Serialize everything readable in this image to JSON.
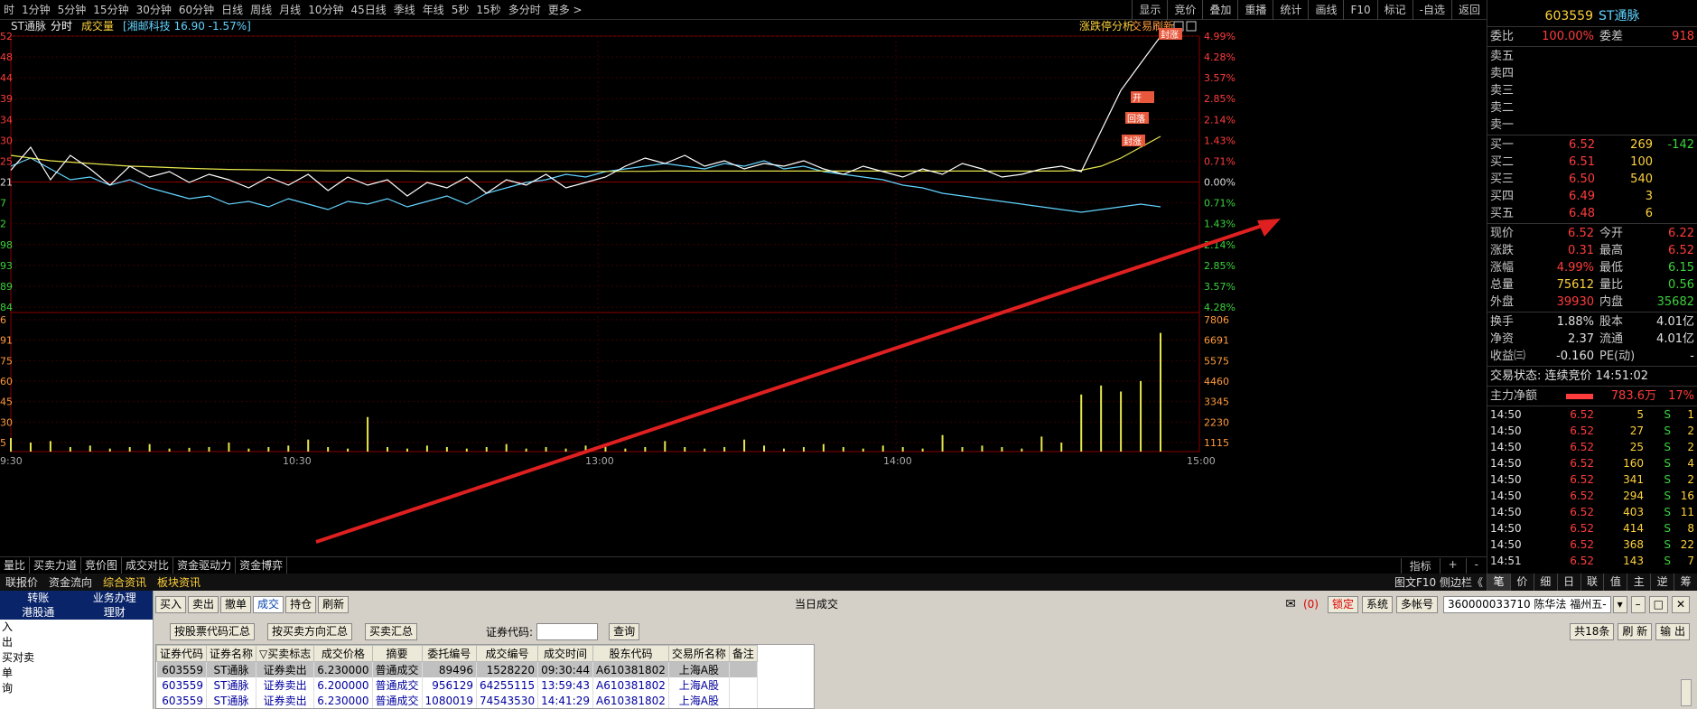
{
  "periods": [
    "时",
    "1分钟",
    "5分钟",
    "15分钟",
    "30分钟",
    "60分钟",
    "日线",
    "周线",
    "月线",
    "10分钟",
    "45日线",
    "季线",
    "年线",
    "5秒",
    "15秒",
    "多分时",
    "更多 >"
  ],
  "top_right": [
    "显示",
    "竞价",
    "叠加",
    "重播",
    "统计",
    "画线",
    "F10",
    "标记",
    "-自选",
    "返回"
  ],
  "chart_header": {
    "name": "ST通脉",
    "mode": "分时",
    "vol": "成交量",
    "compare": "[湘邮科技 16.90 -1.57%]",
    "right1": "涨跌停分析",
    "right2": "交易刷新"
  },
  "chart_data": {
    "type": "line",
    "title": "",
    "pct_axis_right": [
      "4.99%",
      "4.28%",
      "3.57%",
      "2.85%",
      "2.14%",
      "1.43%",
      "0.71%",
      "0.00%",
      "0.71%",
      "1.43%",
      "2.14%",
      "2.85%",
      "3.57%",
      "4.28%"
    ],
    "price_axis_left": [
      "52",
      "48",
      "44",
      "39",
      "34",
      "30",
      "25",
      "21",
      "7",
      "2",
      "98",
      "93",
      "89",
      "84"
    ],
    "vol_axis_right": [
      "7806",
      "6691",
      "5575",
      "4460",
      "3345",
      "2230",
      "1115"
    ],
    "vol_axis_left": [
      "6",
      "91",
      "75",
      "60",
      "45",
      "30",
      "5"
    ],
    "time_labels": [
      "9:30",
      "10:30",
      "13:00",
      "14:00",
      "15:00"
    ],
    "price_series": [
      0.05,
      0.9,
      -0.3,
      0.6,
      0.1,
      -0.5,
      0.2,
      -0.2,
      0.0,
      -0.4,
      -0.1,
      -0.3,
      -0.6,
      -0.2,
      -0.5,
      -0.1,
      -0.7,
      -0.2,
      -0.5,
      -0.3,
      -0.9,
      -0.4,
      -0.6,
      -0.2,
      -0.8,
      -0.3,
      -0.5,
      -0.1,
      -0.6,
      -0.4,
      -0.2,
      0.2,
      0.5,
      0.3,
      0.6,
      0.2,
      0.4,
      0.1,
      0.3,
      0.2,
      0.4,
      0.1,
      -0.1,
      0.2,
      0.0,
      -0.2,
      0.1,
      -0.1,
      0.3,
      0.1,
      -0.2,
      -0.1,
      0.1,
      0.2,
      0.0,
      1.5,
      3.0,
      4.0,
      4.99
    ],
    "avg_series": [
      0.6,
      0.5,
      0.4,
      0.35,
      0.3,
      0.25,
      0.2,
      0.18,
      0.15,
      0.12,
      0.1,
      0.08,
      0.07,
      0.06,
      0.05,
      0.04,
      0.03,
      0.03,
      0.02,
      0.02,
      0.02,
      0.01,
      0.01,
      0.01,
      0.01,
      0.01,
      0.01,
      0.01,
      0.01,
      0.01,
      0.01,
      0.01,
      0.01,
      0.02,
      0.02,
      0.02,
      0.02,
      0.02,
      0.02,
      0.02,
      0.02,
      0.02,
      0.02,
      0.02,
      0.02,
      0.02,
      0.02,
      0.02,
      0.02,
      0.02,
      0.02,
      0.02,
      0.02,
      0.02,
      0.05,
      0.2,
      0.5,
      0.9,
      1.3
    ],
    "compare_series": [
      0.2,
      0.5,
      0.1,
      -0.3,
      -0.2,
      -0.5,
      -0.3,
      -0.6,
      -0.8,
      -1.0,
      -0.9,
      -1.2,
      -1.1,
      -1.3,
      -1.0,
      -1.2,
      -1.4,
      -1.1,
      -1.2,
      -1.0,
      -1.3,
      -1.1,
      -0.9,
      -1.2,
      -0.8,
      -0.6,
      -0.4,
      -0.3,
      -0.1,
      -0.2,
      0.0,
      0.1,
      0.2,
      0.3,
      0.2,
      0.1,
      0.3,
      0.2,
      0.4,
      0.1,
      0.2,
      0.0,
      -0.1,
      -0.2,
      -0.3,
      -0.5,
      -0.6,
      -0.8,
      -0.9,
      -1.0,
      -1.1,
      -1.2,
      -1.3,
      -1.4,
      -1.5,
      -1.4,
      -1.3,
      -1.2,
      -1.3
    ],
    "volume_series": [
      900,
      600,
      700,
      300,
      400,
      200,
      300,
      500,
      200,
      250,
      300,
      600,
      200,
      300,
      400,
      800,
      300,
      200,
      2300,
      300,
      200,
      400,
      300,
      200,
      300,
      500,
      200,
      300,
      200,
      400,
      300,
      200,
      300,
      700,
      300,
      200,
      300,
      800,
      400,
      200,
      300,
      500,
      300,
      200,
      400,
      300,
      200,
      1100,
      300,
      400,
      300,
      200,
      1000,
      600,
      3800,
      4400,
      4000,
      4700,
      7900
    ],
    "labels": [
      "封涨",
      "开",
      "回落",
      "封涨"
    ]
  },
  "side": {
    "code": "603559",
    "name": "ST通脉",
    "tag": "封涨",
    "webi": {
      "l": "委比",
      "v": "100.00%",
      "l2": "委差",
      "v2": "918"
    },
    "sells": [
      {
        "l": "卖五"
      },
      {
        "l": "卖四"
      },
      {
        "l": "卖三"
      },
      {
        "l": "卖二"
      },
      {
        "l": "卖一"
      }
    ],
    "buys": [
      {
        "l": "买一",
        "p": "6.52",
        "v": "269",
        "d": "-142"
      },
      {
        "l": "买二",
        "p": "6.51",
        "v": "100",
        "d": ""
      },
      {
        "l": "买三",
        "p": "6.50",
        "v": "540",
        "d": ""
      },
      {
        "l": "买四",
        "p": "6.49",
        "v": "3",
        "d": ""
      },
      {
        "l": "买五",
        "p": "6.48",
        "v": "6",
        "d": ""
      }
    ],
    "quote": [
      {
        "l": "现价",
        "v": "6.52",
        "l2": "今开",
        "v2": "6.22",
        "c": "red",
        "c2": "red"
      },
      {
        "l": "涨跌",
        "v": "0.31",
        "l2": "最高",
        "v2": "6.52",
        "c": "red",
        "c2": "red"
      },
      {
        "l": "涨幅",
        "v": "4.99%",
        "l2": "最低",
        "v2": "6.15",
        "c": "red",
        "c2": "grn"
      },
      {
        "l": "总量",
        "v": "75612",
        "l2": "量比",
        "v2": "0.56",
        "c": "yel",
        "c2": "grn"
      },
      {
        "l": "外盘",
        "v": "39930",
        "l2": "内盘",
        "v2": "35682",
        "c": "red",
        "c2": "grn"
      }
    ],
    "quote2": [
      {
        "l": "换手",
        "v": "1.88%",
        "l2": "股本",
        "v2": "4.01亿"
      },
      {
        "l": "净资",
        "v": "2.37",
        "l2": "流通",
        "v2": "4.01亿"
      },
      {
        "l": "收益㈢",
        "v": "-0.160",
        "l2": "PE(动)",
        "v2": "-"
      }
    ],
    "status": "交易状态: 连续竞价 14:51:02",
    "mainflow": {
      "l": "主力净额",
      "v": "783.6万",
      "p": "17%"
    },
    "ticks": [
      {
        "t": "14:50",
        "p": "6.52",
        "v": "5",
        "s": "S",
        "n": "1"
      },
      {
        "t": "14:50",
        "p": "6.52",
        "v": "27",
        "s": "S",
        "n": "2"
      },
      {
        "t": "14:50",
        "p": "6.52",
        "v": "25",
        "s": "S",
        "n": "2"
      },
      {
        "t": "14:50",
        "p": "6.52",
        "v": "160",
        "s": "S",
        "n": "4"
      },
      {
        "t": "14:50",
        "p": "6.52",
        "v": "341",
        "s": "S",
        "n": "2"
      },
      {
        "t": "14:50",
        "p": "6.52",
        "v": "294",
        "s": "S",
        "n": "16"
      },
      {
        "t": "14:50",
        "p": "6.52",
        "v": "403",
        "s": "S",
        "n": "11"
      },
      {
        "t": "14:50",
        "p": "6.52",
        "v": "414",
        "s": "S",
        "n": "8"
      },
      {
        "t": "14:50",
        "p": "6.52",
        "v": "368",
        "s": "S",
        "n": "22"
      },
      {
        "t": "14:51",
        "p": "6.52",
        "v": "143",
        "s": "S",
        "n": "7"
      }
    ],
    "tabs": [
      "笔",
      "价",
      "细",
      "日",
      "联",
      "值",
      "主",
      "逆",
      "筹"
    ]
  },
  "bottom_tabs": [
    "量比",
    "买卖力道",
    "竞价图",
    "成交对比",
    "资金驱动力",
    "资金博弈"
  ],
  "bottom_right": [
    "指标",
    "+",
    "-"
  ],
  "info_tabs": [
    "联报价",
    "资金流向",
    "综合资讯",
    "板块资讯"
  ],
  "info_right": "图文F10 侧边栏《",
  "trade": {
    "nav_head": [
      "转账",
      "业务办理",
      "港股通",
      "理财"
    ],
    "nav_items": [
      "入",
      "出",
      "买对卖",
      "单",
      "询"
    ],
    "toolbar": [
      "买入",
      "卖出",
      "撤单",
      "成交",
      "持仓",
      "刷新"
    ],
    "title": "当日成交",
    "msg": "(0)",
    "right_btns": [
      "锁定",
      "系统",
      "多帐号"
    ],
    "account": "360000033710 陈华法 福州五-",
    "sub_btns": [
      "按股票代码汇总",
      "按买卖方向汇总",
      "买卖汇总"
    ],
    "code_label": "证券代码:",
    "query": "查询",
    "count": "共18条",
    "refresh": "刷 新",
    "export": "输 出",
    "headers": [
      "证券代码",
      "证券名称",
      "▽买卖标志",
      "成交价格",
      "摘要",
      "委托编号",
      "成交编号",
      "成交时间",
      "股东代码",
      "交易所名称",
      "备注"
    ],
    "rows": [
      [
        "603559",
        "ST通脉",
        "证券卖出",
        "6.230000",
        "普通成交",
        "89496",
        "1528220",
        "09:30:44",
        "A610381802",
        "上海A股",
        ""
      ],
      [
        "603559",
        "ST通脉",
        "证券卖出",
        "6.200000",
        "普通成交",
        "956129",
        "64255115",
        "13:59:43",
        "A610381802",
        "上海A股",
        ""
      ],
      [
        "603559",
        "ST通脉",
        "证券卖出",
        "6.230000",
        "普通成交",
        "1080019",
        "74543530",
        "14:41:29",
        "A610381802",
        "上海A股",
        ""
      ]
    ]
  }
}
